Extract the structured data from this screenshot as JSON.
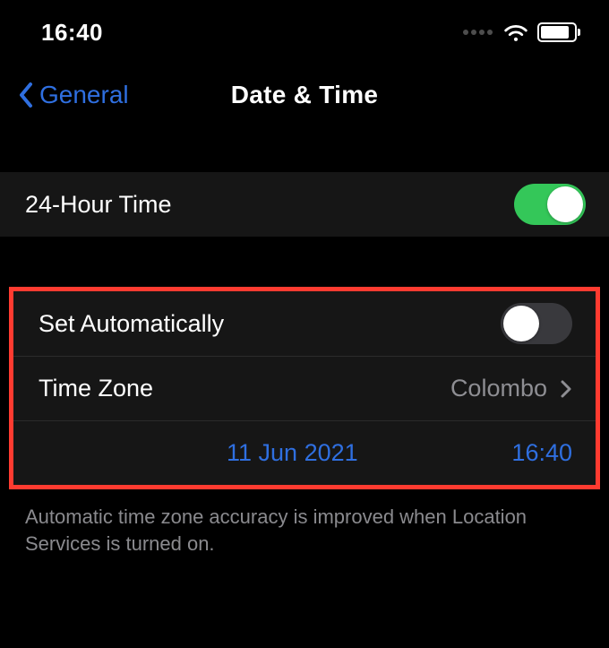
{
  "status": {
    "time": "16:40"
  },
  "nav": {
    "back_label": "General",
    "title": "Date & Time"
  },
  "rows": {
    "hour24_label": "24-Hour Time",
    "hour24_on": true,
    "set_auto_label": "Set Automatically",
    "set_auto_on": false,
    "timezone_label": "Time Zone",
    "timezone_value": "Colombo",
    "date_value": "11 Jun 2021",
    "time_value": "16:40"
  },
  "footer": {
    "note": "Automatic time zone accuracy is improved when Location Services is turned on."
  },
  "colors": {
    "accent_blue": "#2f6fe0",
    "toggle_green": "#34c759",
    "highlight_red": "#ff3b30"
  }
}
